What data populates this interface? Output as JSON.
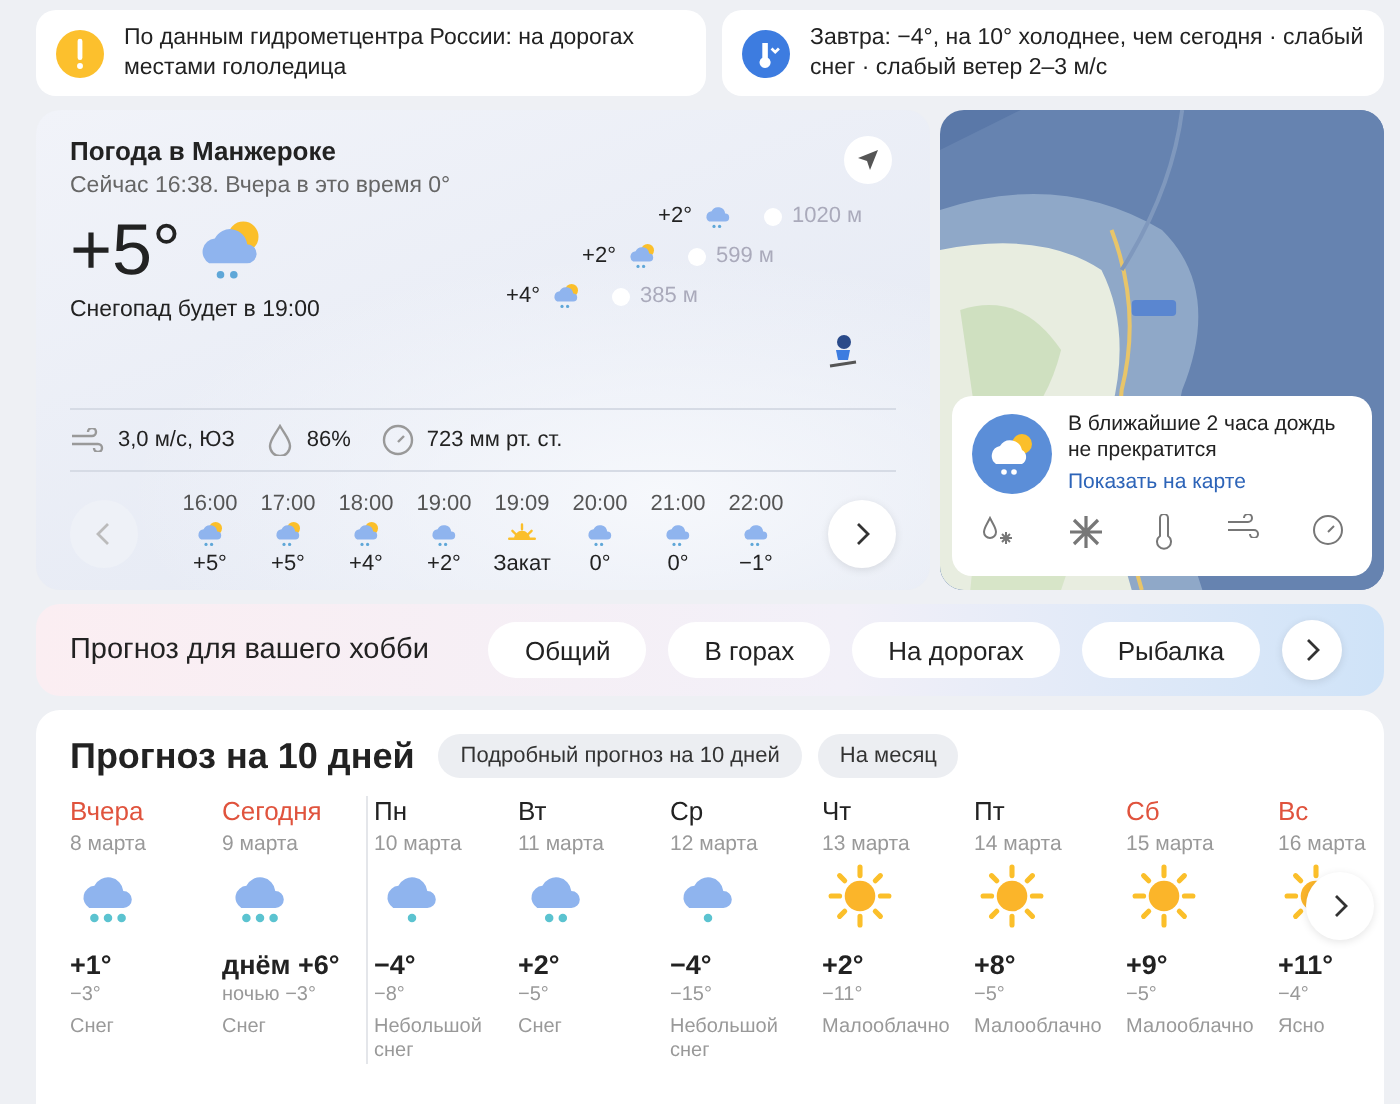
{
  "alerts": [
    {
      "kind": "warning",
      "text": "По данным гидрометцентра России: на дорогах местами гололедица"
    },
    {
      "kind": "temperature",
      "text": "Завтра: −4°, на 10° холоднее, чем сегодня · слабый снег · слабый ветер 2–3 м/с"
    }
  ],
  "current": {
    "title": "Погода в Манжероке",
    "subtitle": "Сейчас 16:38. Вчера в это время 0°",
    "temperature": "+5°",
    "kind": "rain_sun",
    "forecast_note": "Снегопад будет в 19:00",
    "altitudes": [
      {
        "temperature": "+2°",
        "kind": "rain",
        "height": "1020 м"
      },
      {
        "temperature": "+2°",
        "kind": "rain_sun",
        "height": "599 м"
      },
      {
        "temperature": "+4°",
        "kind": "rain_sun",
        "height": "385 м"
      }
    ],
    "wind": "3,0 м/с, ЮЗ",
    "humidity": "86%",
    "pressure": "723 мм рт. ст.",
    "hourly": [
      {
        "time": "16:00",
        "kind": "rain_sun",
        "value": "+5°"
      },
      {
        "time": "17:00",
        "kind": "rain_sun",
        "value": "+5°"
      },
      {
        "time": "18:00",
        "kind": "rain_sun",
        "value": "+4°"
      },
      {
        "time": "19:00",
        "kind": "rain",
        "value": "+2°"
      },
      {
        "time": "19:09",
        "kind": "sunset",
        "value": "Закат"
      },
      {
        "time": "20:00",
        "kind": "rain",
        "value": "0°"
      },
      {
        "time": "21:00",
        "kind": "rain",
        "value": "0°"
      },
      {
        "time": "22:00",
        "kind": "rain",
        "value": "−1°"
      }
    ]
  },
  "map": {
    "nowcast": {
      "text": "В ближайшие 2 часа дождь не прекратится",
      "link": "Показать на карте"
    }
  },
  "hobby": {
    "title": "Прогноз для вашего хобби",
    "tabs": [
      "Общий",
      "В горах",
      "На дорогах",
      "Рыбалка"
    ]
  },
  "ten_day": {
    "title": "Прогноз на 10 дней",
    "links": [
      "Подробный прогноз на 10 дней",
      "На месяц"
    ],
    "days": [
      {
        "name": "Вчера",
        "color": "#e0533d",
        "date": "8 марта",
        "kind": "snow3",
        "day": "+1°",
        "night": "−3°",
        "condition": "Снег"
      },
      {
        "name": "Сегодня",
        "color": "#e0533d",
        "date": "9 марта",
        "kind": "snow3",
        "day": "днём +6°",
        "night": "ночью −3°",
        "condition": "Снег"
      },
      {
        "name": "Пн",
        "color": "#222222",
        "date": "10 марта",
        "kind": "snow1",
        "day": "−4°",
        "night": "−8°",
        "condition": "Небольшой снег"
      },
      {
        "name": "Вт",
        "color": "#222222",
        "date": "11 марта",
        "kind": "snow2",
        "day": "+2°",
        "night": "−5°",
        "condition": "Снег"
      },
      {
        "name": "Ср",
        "color": "#222222",
        "date": "12 марта",
        "kind": "snow1",
        "day": "−4°",
        "night": "−15°",
        "condition": "Небольшой снег"
      },
      {
        "name": "Чт",
        "color": "#222222",
        "date": "13 марта",
        "kind": "sun",
        "day": "+2°",
        "night": "−11°",
        "condition": "Малооблачно"
      },
      {
        "name": "Пт",
        "color": "#222222",
        "date": "14 марта",
        "kind": "sun",
        "day": "+8°",
        "night": "−5°",
        "condition": "Малооблачно"
      },
      {
        "name": "Сб",
        "color": "#e0533d",
        "date": "15 марта",
        "kind": "sun",
        "day": "+9°",
        "night": "−5°",
        "condition": "Малооблачно"
      },
      {
        "name": "Вс",
        "color": "#e0533d",
        "date": "16 марта",
        "kind": "sun",
        "day": "+11°",
        "night": "−4°",
        "condition": "Ясно"
      }
    ]
  }
}
